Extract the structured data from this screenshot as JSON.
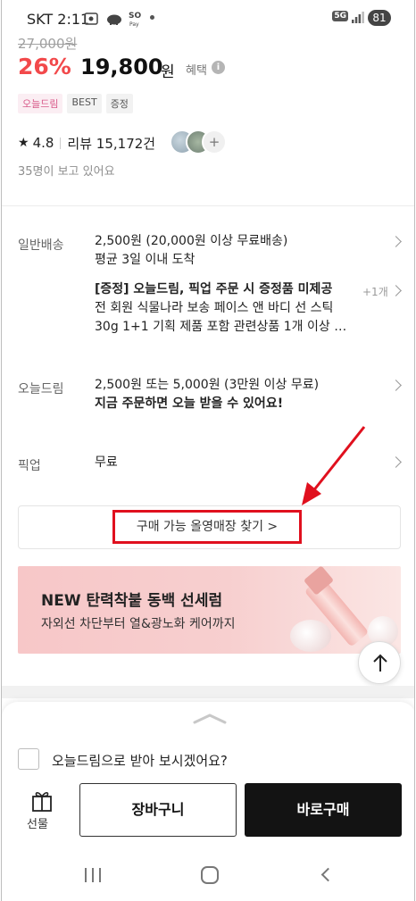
{
  "status_bar": {
    "carrier_time": "SKT 2:11",
    "icons": [
      "screenshot-icon",
      "pay-icon",
      "dot-icon"
    ],
    "pay_text": "Pay",
    "network": "5G",
    "battery": "81"
  },
  "product": {
    "original_price": "27,000원",
    "discount": "26%",
    "price": "19,800",
    "price_unit": "원",
    "benefit_label": "혜택",
    "tags": [
      "오늘드림",
      "BEST",
      "증정"
    ],
    "rating": "4.8",
    "review_label": "리뷰 15,172건",
    "avatar_more": "+",
    "viewing": "35명이 보고 있어요"
  },
  "shipping": {
    "general": {
      "label": "일반배송",
      "line1": "2,500원 (20,000원 이상 무료배송)",
      "line2": "평균 3일 이내 도착"
    },
    "gift": {
      "title": "[증정] 오늘드림, 픽업 주문 시 증정품 미제공",
      "line2": "전 회원 식물나라 보송 페이스 앤 바디 선 스틱",
      "line3": "30g 1+1 기획 제품 포함 관련상품 1개 이상 …",
      "count": "+1개"
    },
    "today": {
      "label": "오늘드림",
      "line1": "2,500원 또는 5,000원 (3만원 이상 무료)",
      "line2": "지금 주문하면 오늘 받을 수 있어요!"
    },
    "pickup": {
      "label": "픽업",
      "value": "무료"
    }
  },
  "store_finder": {
    "label": "구매 가능 올영매장 찾기 >"
  },
  "banner": {
    "title": "NEW 탄력착붙 동백 선세럼",
    "subtitle": "자외선 차단부터 열&광노화 케어까지"
  },
  "bottom_sheet": {
    "checkbox_label": "오늘드림으로 받아 보시겠어요?",
    "checkbox_checked": false,
    "gift_label": "선물",
    "cart_label": "장바구니",
    "buy_label": "바로구매"
  },
  "colors": {
    "discount": "#f2494b",
    "highlight_box": "#e0101e",
    "buy_button": "#131313"
  }
}
